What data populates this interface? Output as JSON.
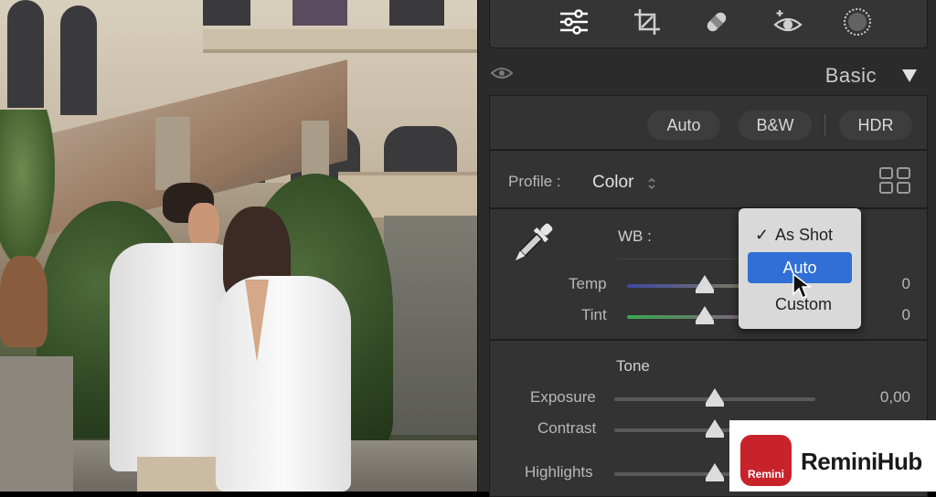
{
  "panel": {
    "tools": [
      {
        "icon": "sliders-icon"
      },
      {
        "icon": "crop-icon"
      },
      {
        "icon": "healing-bandage-icon"
      },
      {
        "icon": "red-eye-icon"
      },
      {
        "icon": "masking-circle-icon"
      }
    ],
    "section_title": "Basic",
    "treatment": {
      "auto": "Auto",
      "bw": "B&W",
      "hdr": "HDR"
    },
    "profile": {
      "label": "Profile :",
      "value": "Color"
    },
    "wb": {
      "label": "WB :",
      "temp_label": "Temp",
      "temp_value": "0",
      "temp_level": 0.5,
      "tint_label": "Tint",
      "tint_value": "0",
      "tint_level": 0.5,
      "menu": {
        "items": [
          "As Shot",
          "Auto",
          "Custom"
        ],
        "checked": "As Shot",
        "highlighted": "Auto"
      }
    },
    "tone": {
      "title": "Tone",
      "exposure_label": "Exposure",
      "exposure_value": "0,00",
      "exposure_level": 0.5,
      "contrast_label": "Contrast",
      "highlights_label": "Highlights"
    }
  },
  "watermark": {
    "logo_text": "Remini",
    "name": "ReminiHub",
    "brand_color": "#c8222a"
  },
  "colors": {
    "panel_bg": "#2b2b2b",
    "selection_blue": "#2f6fd6"
  }
}
